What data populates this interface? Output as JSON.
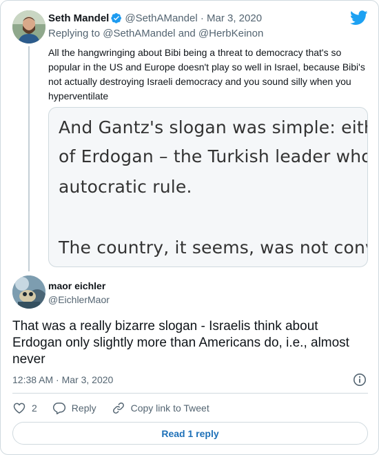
{
  "parent_tweet": {
    "name": "Seth Mandel",
    "handle": "@SethAMandel",
    "separator": "·",
    "date": "Mar 3, 2020",
    "replying_prefix": "Replying to",
    "replying_to_1": "@SethAMandel",
    "replying_and": "and",
    "replying_to_2": "@HerbKeinon",
    "text": "All the hangwringing about Bibi being a threat to democracy that's so popular in the US and Europe doesn't play so well in Israel, because Bibi's not actually destroying Israeli democracy and you sound silly when you hyperventilate",
    "image_lines": [
      "And Gantz's slogan was simple: eith",
      "of Erdogan – the Turkish leader who",
      "autocratic rule.",
      "The country, it seems, was not convi"
    ]
  },
  "reply_tweet": {
    "name": "maor eichler",
    "handle": "@EichlerMaor",
    "text": "That was a really bizarre slogan - Israelis think about Erdogan only slightly more than Americans do, i.e., almost never",
    "time": "12:38 AM",
    "separator": "·",
    "date": "Mar 3, 2020"
  },
  "actions": {
    "like_count": "2",
    "reply_label": "Reply",
    "copy_label": "Copy link to Tweet"
  },
  "read_reply_label": "Read 1 reply",
  "icons": {
    "verified": "verified-badge-icon",
    "brand": "twitter-bird-icon",
    "info": "info-icon",
    "like": "heart-icon",
    "reply": "speech-bubble-icon",
    "copy": "link-icon"
  },
  "colors": {
    "brand": "#1da1f2",
    "verified": "#1d9bf0",
    "link": "#1d70b8",
    "secondary_text": "#536471"
  }
}
